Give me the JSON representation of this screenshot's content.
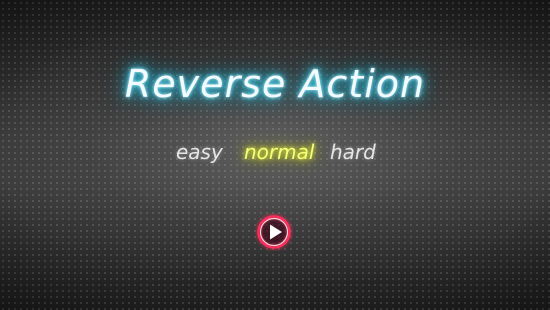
{
  "game": {
    "title": "Reverse Action"
  },
  "difficulty": {
    "options": [
      {
        "label": "easy",
        "selected": false
      },
      {
        "label": "normal",
        "selected": true
      },
      {
        "label": "hard",
        "selected": false
      }
    ]
  },
  "play_button": {
    "icon": "play-icon",
    "ring_color": "#ff2d5a"
  },
  "colors": {
    "title_glow": "#3fd4f0",
    "selected_glow": "#e8f23a",
    "unselected_text": "#e6e6e6"
  }
}
